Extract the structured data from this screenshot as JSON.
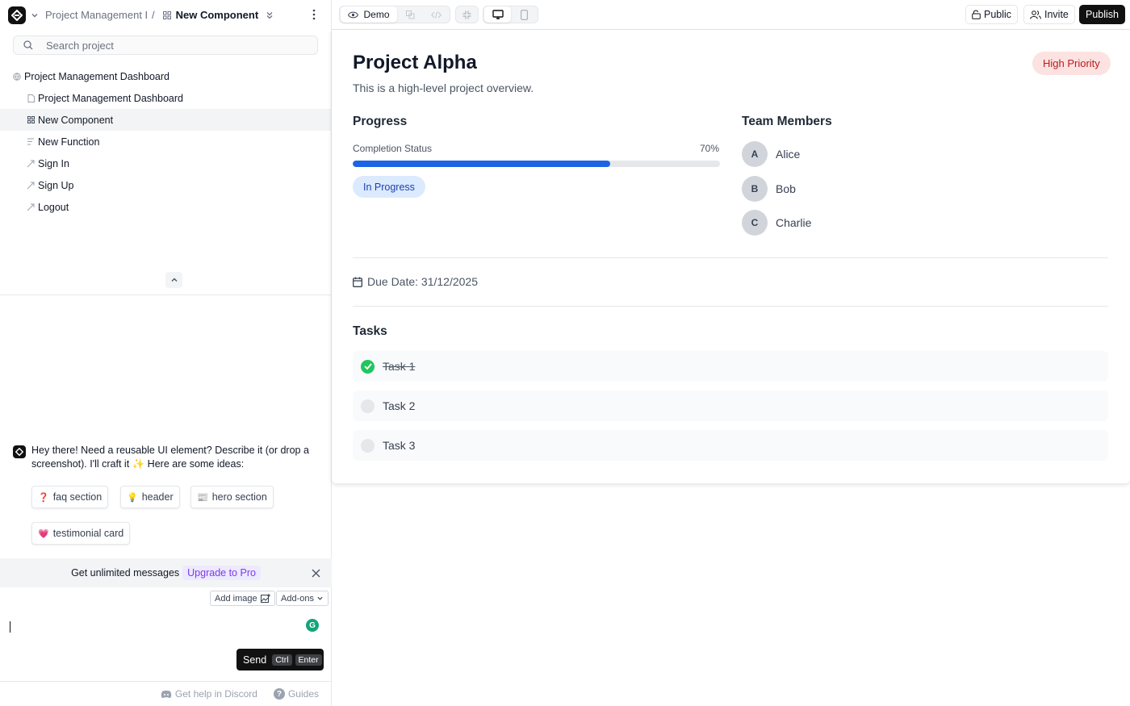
{
  "breadcrumb": {
    "project": "Project Management Da",
    "separator": "/",
    "current": "New Component"
  },
  "search": {
    "placeholder": "Search project"
  },
  "tree": {
    "root": "Project Management Dashboard",
    "items": [
      {
        "label": "Project Management Dashboard",
        "icon": "page-icon",
        "active": false
      },
      {
        "label": "New Component",
        "icon": "component-icon",
        "active": true
      },
      {
        "label": "New Function",
        "icon": "function-icon",
        "active": false
      },
      {
        "label": "Sign In",
        "icon": "link-icon",
        "active": false
      },
      {
        "label": "Sign Up",
        "icon": "link-icon",
        "active": false
      },
      {
        "label": "Logout",
        "icon": "link-icon",
        "active": false
      }
    ]
  },
  "chat": {
    "message": "Hey there! Need a reusable UI element? Describe it (or drop a screenshot). I'll craft it ✨ Here are some ideas:",
    "suggestions": [
      {
        "emoji": "❓",
        "label": "faq section"
      },
      {
        "emoji": "💡",
        "label": "header"
      },
      {
        "emoji": "📰",
        "label": "hero section"
      },
      {
        "emoji": "💗",
        "label": "testimonial card"
      }
    ]
  },
  "upgrade": {
    "text": "Get unlimited messages",
    "cta": "Upgrade to Pro"
  },
  "composer": {
    "add_image": "Add image",
    "addons": "Add-ons",
    "send": "Send",
    "kbd_ctrl": "Ctrl",
    "kbd_enter": "Enter",
    "grammarly": "G"
  },
  "footer": {
    "discord": "Get help in Discord",
    "guides": "Guides"
  },
  "toolbar": {
    "demo": "Demo",
    "public": "Public",
    "invite": "Invite",
    "publish": "Publish"
  },
  "project": {
    "title": "Project Alpha",
    "subtitle": "This is a high-level project overview.",
    "priority": "High Priority",
    "progress_heading": "Progress",
    "completion_label": "Completion Status",
    "completion_pct_text": "70%",
    "completion_value": 0.7,
    "status": "In Progress",
    "team_heading": "Team Members",
    "members": [
      {
        "initial": "A",
        "name": "Alice"
      },
      {
        "initial": "B",
        "name": "Bob"
      },
      {
        "initial": "C",
        "name": "Charlie"
      }
    ],
    "due_date": "Due Date: 31/12/2025",
    "tasks_heading": "Tasks",
    "tasks": [
      {
        "label": "Task 1",
        "done": true
      },
      {
        "label": "Task 2",
        "done": false
      },
      {
        "label": "Task 3",
        "done": false
      }
    ]
  },
  "colors": {
    "accent": "#1d63e6",
    "priority_bg": "#fde2e2",
    "priority_text": "#b91c1c",
    "done": "#22c55e",
    "upgrade": "#7c3aed"
  }
}
